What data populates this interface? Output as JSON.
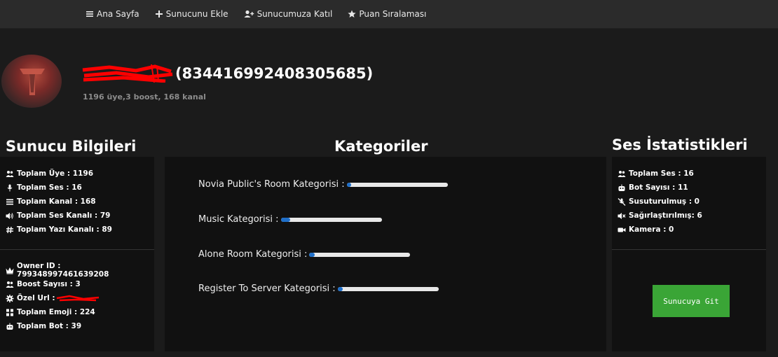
{
  "nav": [
    {
      "label": "Ana Sayfa",
      "icon": "bars-icon"
    },
    {
      "label": "Sunucunu Ekle",
      "icon": "plus-icon"
    },
    {
      "label": "Sunucumuza Katıl",
      "icon": "user-plus-icon"
    },
    {
      "label": "Puan Sıralaması",
      "icon": "star-icon"
    }
  ],
  "server": {
    "id_text": "(834416992408305685)",
    "subtitle": "1196 üye,3 boost, 168 kanal"
  },
  "headings": {
    "info": "Sunucu Bilgileri",
    "categories": "Kategoriler",
    "voice": "Ses İstatistikleri"
  },
  "info_top": [
    {
      "label": "Toplam Üye : 1196",
      "icon": "users-icon"
    },
    {
      "label": "Toplam Ses : 16",
      "icon": "microphone-icon"
    },
    {
      "label": "Toplam Kanal : 168",
      "icon": "list-icon"
    },
    {
      "label": "Toplam Ses Kanalı : 79",
      "icon": "volume-icon"
    },
    {
      "label": "Toplam Yazı Kanalı : 89",
      "icon": "hash-icon"
    }
  ],
  "info_bottom": [
    {
      "label": "Owner ID : 799348997461639208",
      "icon": "crown-icon"
    },
    {
      "label": "Boost Sayısı : 3",
      "icon": "users-icon"
    },
    {
      "label": "Özel Url :",
      "icon": "gear-icon"
    },
    {
      "label": "Toplam Emoji : 224",
      "icon": "grid-icon"
    },
    {
      "label": "Toplam Bot : 39",
      "icon": "robot-icon"
    }
  ],
  "categories": [
    {
      "label": "Novia Public's Room Kategorisi :",
      "progress": 0.04
    },
    {
      "label": "Music Kategorisi :",
      "progress": 0.09
    },
    {
      "label": "Alone Room Kategorisi :",
      "progress": 0.05
    },
    {
      "label": "Register To Server Kategorisi :",
      "progress": 0.05
    }
  ],
  "voice_stats": [
    {
      "label": "Toplam Ses : 16",
      "icon": "users-icon"
    },
    {
      "label": "Bot Sayısı : 11",
      "icon": "robot-icon"
    },
    {
      "label": "Susuturulmuş : 0",
      "icon": "mic-muted-icon"
    },
    {
      "label": "Sağırlaştırılmış: 6",
      "icon": "speaker-muted-icon"
    },
    {
      "label": "Kamera : 0",
      "icon": "camera-icon"
    }
  ],
  "button": {
    "label": "Sunucuya Git"
  },
  "colors": {
    "accent_green": "#3aa536",
    "progress_blue": "#1f6fc9",
    "redaction": "#ff0000"
  }
}
